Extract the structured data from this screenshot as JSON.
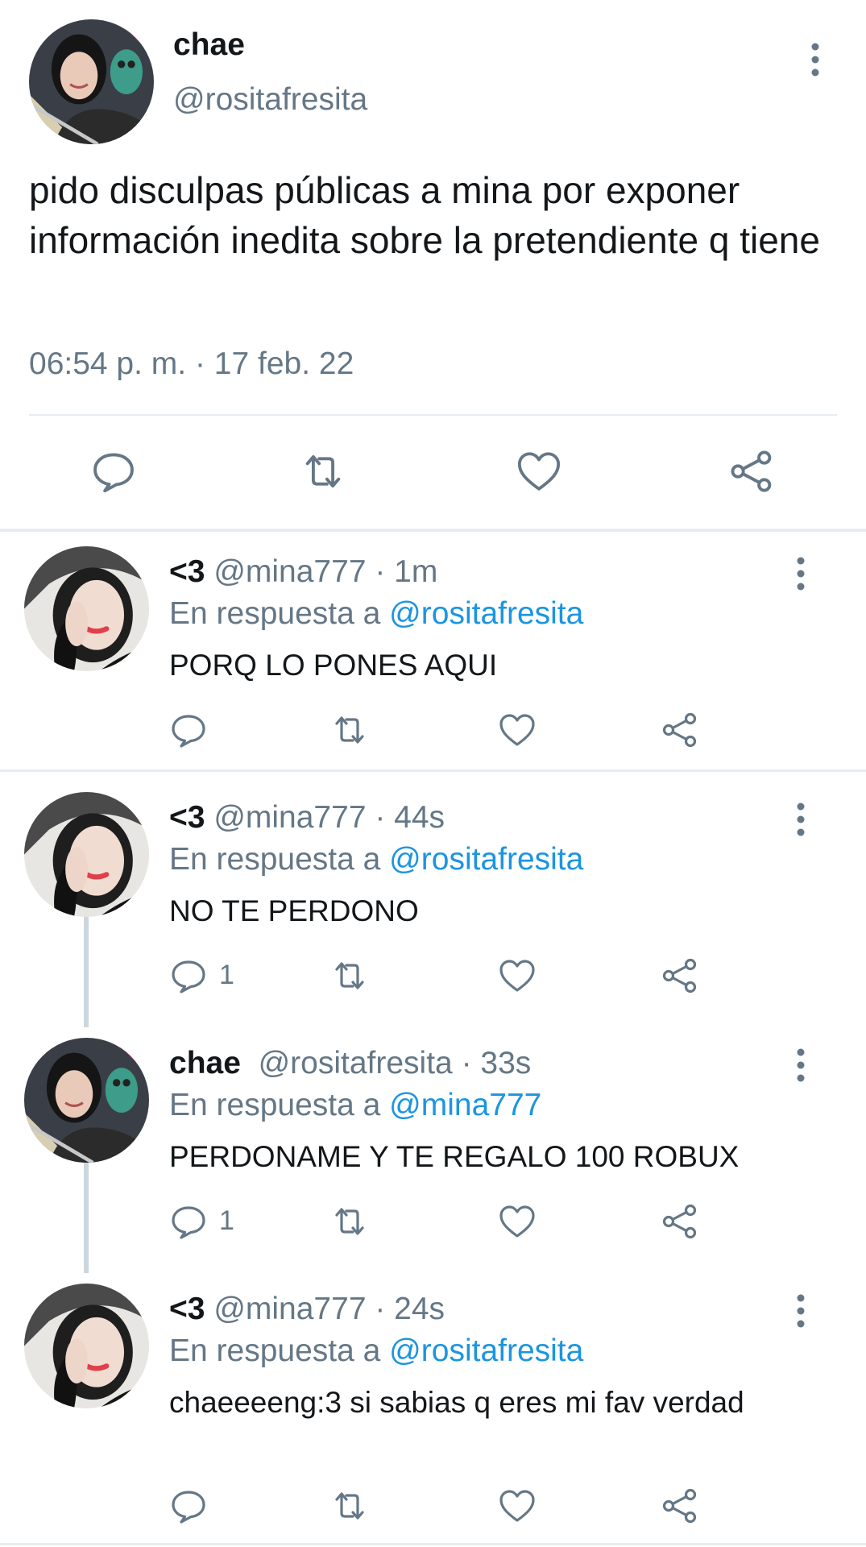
{
  "main_tweet": {
    "name": "chae",
    "handle": "@rositafresita",
    "text": "pido disculpas públicas a mina por exponer información inedita sobre la pretendiente q tiene",
    "meta": "06:54 p. m. · 17 feb. 22",
    "icons": {
      "avatar": "user-avatar-photo",
      "more": "more-vertical-icon",
      "reply": "reply-icon",
      "retweet": "retweet-icon",
      "like": "heart-icon",
      "share": "share-icon"
    }
  },
  "replies": [
    {
      "name": "<3",
      "handle": "@mina777",
      "time": "· 1m",
      "context_prefix": "En respuesta a ",
      "context_link": "@rositafresita",
      "text": "PORQ LO PONES AQUI",
      "reply_count": ""
    },
    {
      "name": "<3",
      "handle": "@mina777",
      "time": "· 44s",
      "context_prefix": "En respuesta a ",
      "context_link": "@rositafresita",
      "text": "NO TE PERDONO",
      "reply_count": "1"
    },
    {
      "name": "chae",
      "handle": "@rositafresita",
      "time": "· 33s",
      "context_prefix": "En respuesta a ",
      "context_link": "@mina777",
      "text": "PERDONAME Y TE REGALO 100 ROBUX",
      "reply_count": "1"
    },
    {
      "name": "<3",
      "handle": "@mina777",
      "time": "· 24s",
      "context_prefix": "En respuesta a ",
      "context_link": "@rositafresita",
      "text": "chaeeeeng:3 si sabias q eres mi fav verdad",
      "reply_count": ""
    }
  ],
  "colors": {
    "text": "#14171a",
    "secondary": "#657786",
    "link": "#1b95e0",
    "divider": "#e6ecf0",
    "icon": "#657786"
  }
}
